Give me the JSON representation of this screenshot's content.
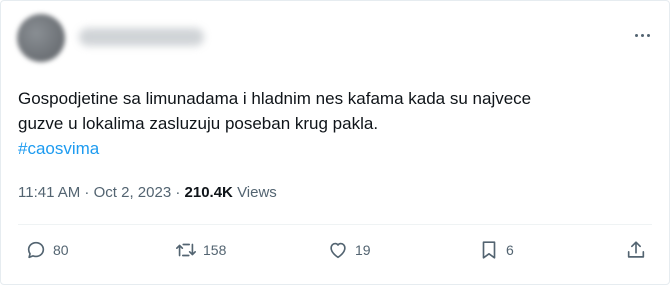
{
  "tweet": {
    "text_line1": "Gospodjetine sa limunadama i hladnim nes kafama kada su najvece",
    "text_line2": "guzve u lokalima zasluzuju poseban krug pakla.",
    "hashtag": "#caosvima",
    "time": "11:41 AM",
    "date": "Oct 2, 2023",
    "separator": " · ",
    "views_count": "210.4K",
    "views_label": "Views"
  },
  "actions": {
    "replies": "80",
    "retweets": "158",
    "likes": "19",
    "bookmarks": "6"
  },
  "icons": {
    "more": "more-horizontal-icon",
    "reply": "reply-icon",
    "retweet": "retweet-icon",
    "like": "heart-icon",
    "bookmark": "bookmark-icon",
    "share": "share-icon"
  },
  "colors": {
    "text": "#0f1419",
    "secondary": "#536471",
    "link": "#1d9bf0",
    "border": "#eff3f4"
  }
}
